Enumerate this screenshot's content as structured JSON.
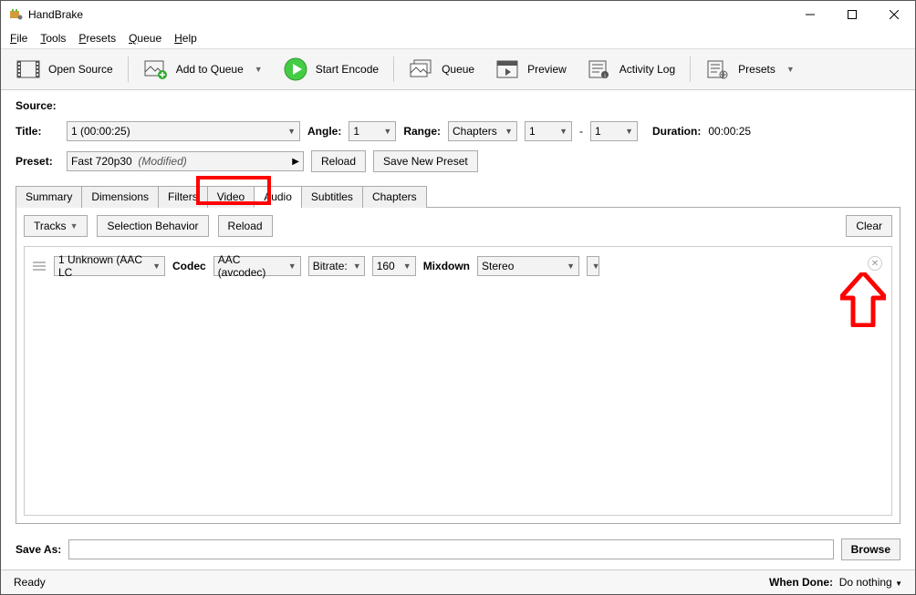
{
  "window": {
    "title": "HandBrake"
  },
  "menu": {
    "file": "File",
    "tools": "Tools",
    "presets": "Presets",
    "queue": "Queue",
    "help": "Help"
  },
  "toolbar": {
    "open_source": "Open Source",
    "add_to_queue": "Add to Queue",
    "start_encode": "Start Encode",
    "queue": "Queue",
    "preview": "Preview",
    "activity_log": "Activity Log",
    "presets": "Presets"
  },
  "source": {
    "label": "Source:"
  },
  "title_row": {
    "title_label": "Title:",
    "title_value": "1  (00:00:25)",
    "angle_label": "Angle:",
    "angle_value": "1",
    "range_label": "Range:",
    "range_type": "Chapters",
    "range_from": "1",
    "range_dash": "-",
    "range_to": "1",
    "duration_label": "Duration:",
    "duration_value": "00:00:25"
  },
  "preset_row": {
    "label": "Preset:",
    "value": "Fast 720p30",
    "modified": "(Modified)",
    "reload": "Reload",
    "save_new": "Save New Preset"
  },
  "tabs": [
    "Summary",
    "Dimensions",
    "Filters",
    "Video",
    "Audio",
    "Subtitles",
    "Chapters"
  ],
  "audio": {
    "tracks_btn": "Tracks",
    "selection_behavior": "Selection Behavior",
    "reload": "Reload",
    "clear": "Clear",
    "track_source": "1 Unknown (AAC LC",
    "codec_label": "Codec",
    "codec_value": "AAC (avcodec)",
    "bitrate_label": "Bitrate:",
    "bitrate_value": "160",
    "mixdown_label": "Mixdown",
    "mixdown_value": "Stereo"
  },
  "saveas": {
    "label": "Save As:",
    "value": "",
    "browse": "Browse"
  },
  "status": {
    "ready": "Ready",
    "when_done_label": "When Done:",
    "when_done_value": "Do nothing"
  }
}
